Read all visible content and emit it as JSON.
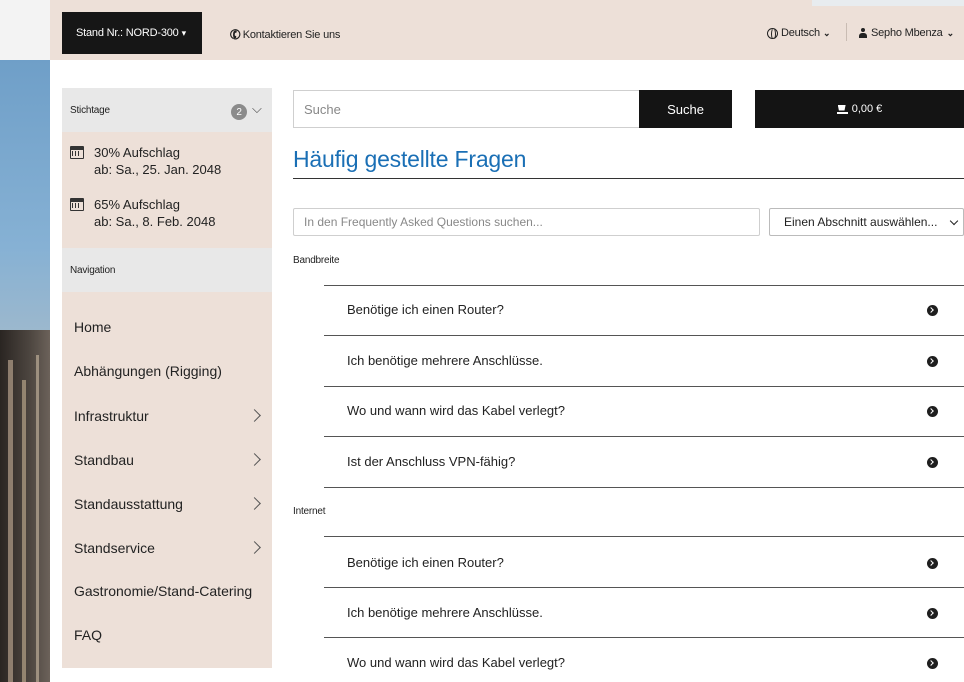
{
  "topbar": {
    "stand_label": "Stand Nr.: NORD-300",
    "stand_caret": "▾",
    "contact_label": "Kontaktieren Sie uns",
    "language_label": "Deutsch",
    "user_label": "Sepho Mbenza"
  },
  "sidebar": {
    "deadlines_title": "Stichtage",
    "deadlines_count": "2",
    "fees": [
      {
        "line1": "30% Aufschlag",
        "line2": "ab: Sa., 25. Jan. 2048"
      },
      {
        "line1": "65% Aufschlag",
        "line2": "ab: Sa., 8. Feb. 2048"
      }
    ],
    "nav_title": "Navigation",
    "nav_items": [
      {
        "label": "Home",
        "has_submenu": false
      },
      {
        "label": "Abhängungen (Rigging)",
        "has_submenu": false
      },
      {
        "label": "Infrastruktur",
        "has_submenu": true
      },
      {
        "label": "Standbau",
        "has_submenu": true
      },
      {
        "label": "Standausstattung",
        "has_submenu": true
      },
      {
        "label": "Standservice",
        "has_submenu": true
      },
      {
        "label": "Gastronomie/Stand-Catering",
        "has_submenu": false
      },
      {
        "label": "FAQ",
        "has_submenu": false
      }
    ]
  },
  "search": {
    "placeholder": "Suche",
    "button_label": "Suche"
  },
  "cart": {
    "total": "0,00 €"
  },
  "main": {
    "title": "Häufig gestellte Fragen",
    "faq_search_placeholder": "In den Frequently Asked Questions suchen...",
    "section_select_value": "Einen Abschnitt auswählen...",
    "groups": [
      {
        "label": "Bandbreite",
        "questions": [
          "Benötige ich einen Router?",
          "Ich benötige mehrere Anschlüsse.",
          "Wo und wann wird das Kabel verlegt?",
          "Ist der Anschluss VPN-fähig?"
        ]
      },
      {
        "label": "Internet",
        "questions": [
          "Benötige ich einen Router?",
          "Ich benötige mehrere Anschlüsse.",
          "Wo und wann wird das Kabel verlegt?"
        ]
      }
    ]
  },
  "colors": {
    "accent_blue": "#1a6fb5",
    "panel_beige": "#ede0d8",
    "dark": "#141414"
  }
}
